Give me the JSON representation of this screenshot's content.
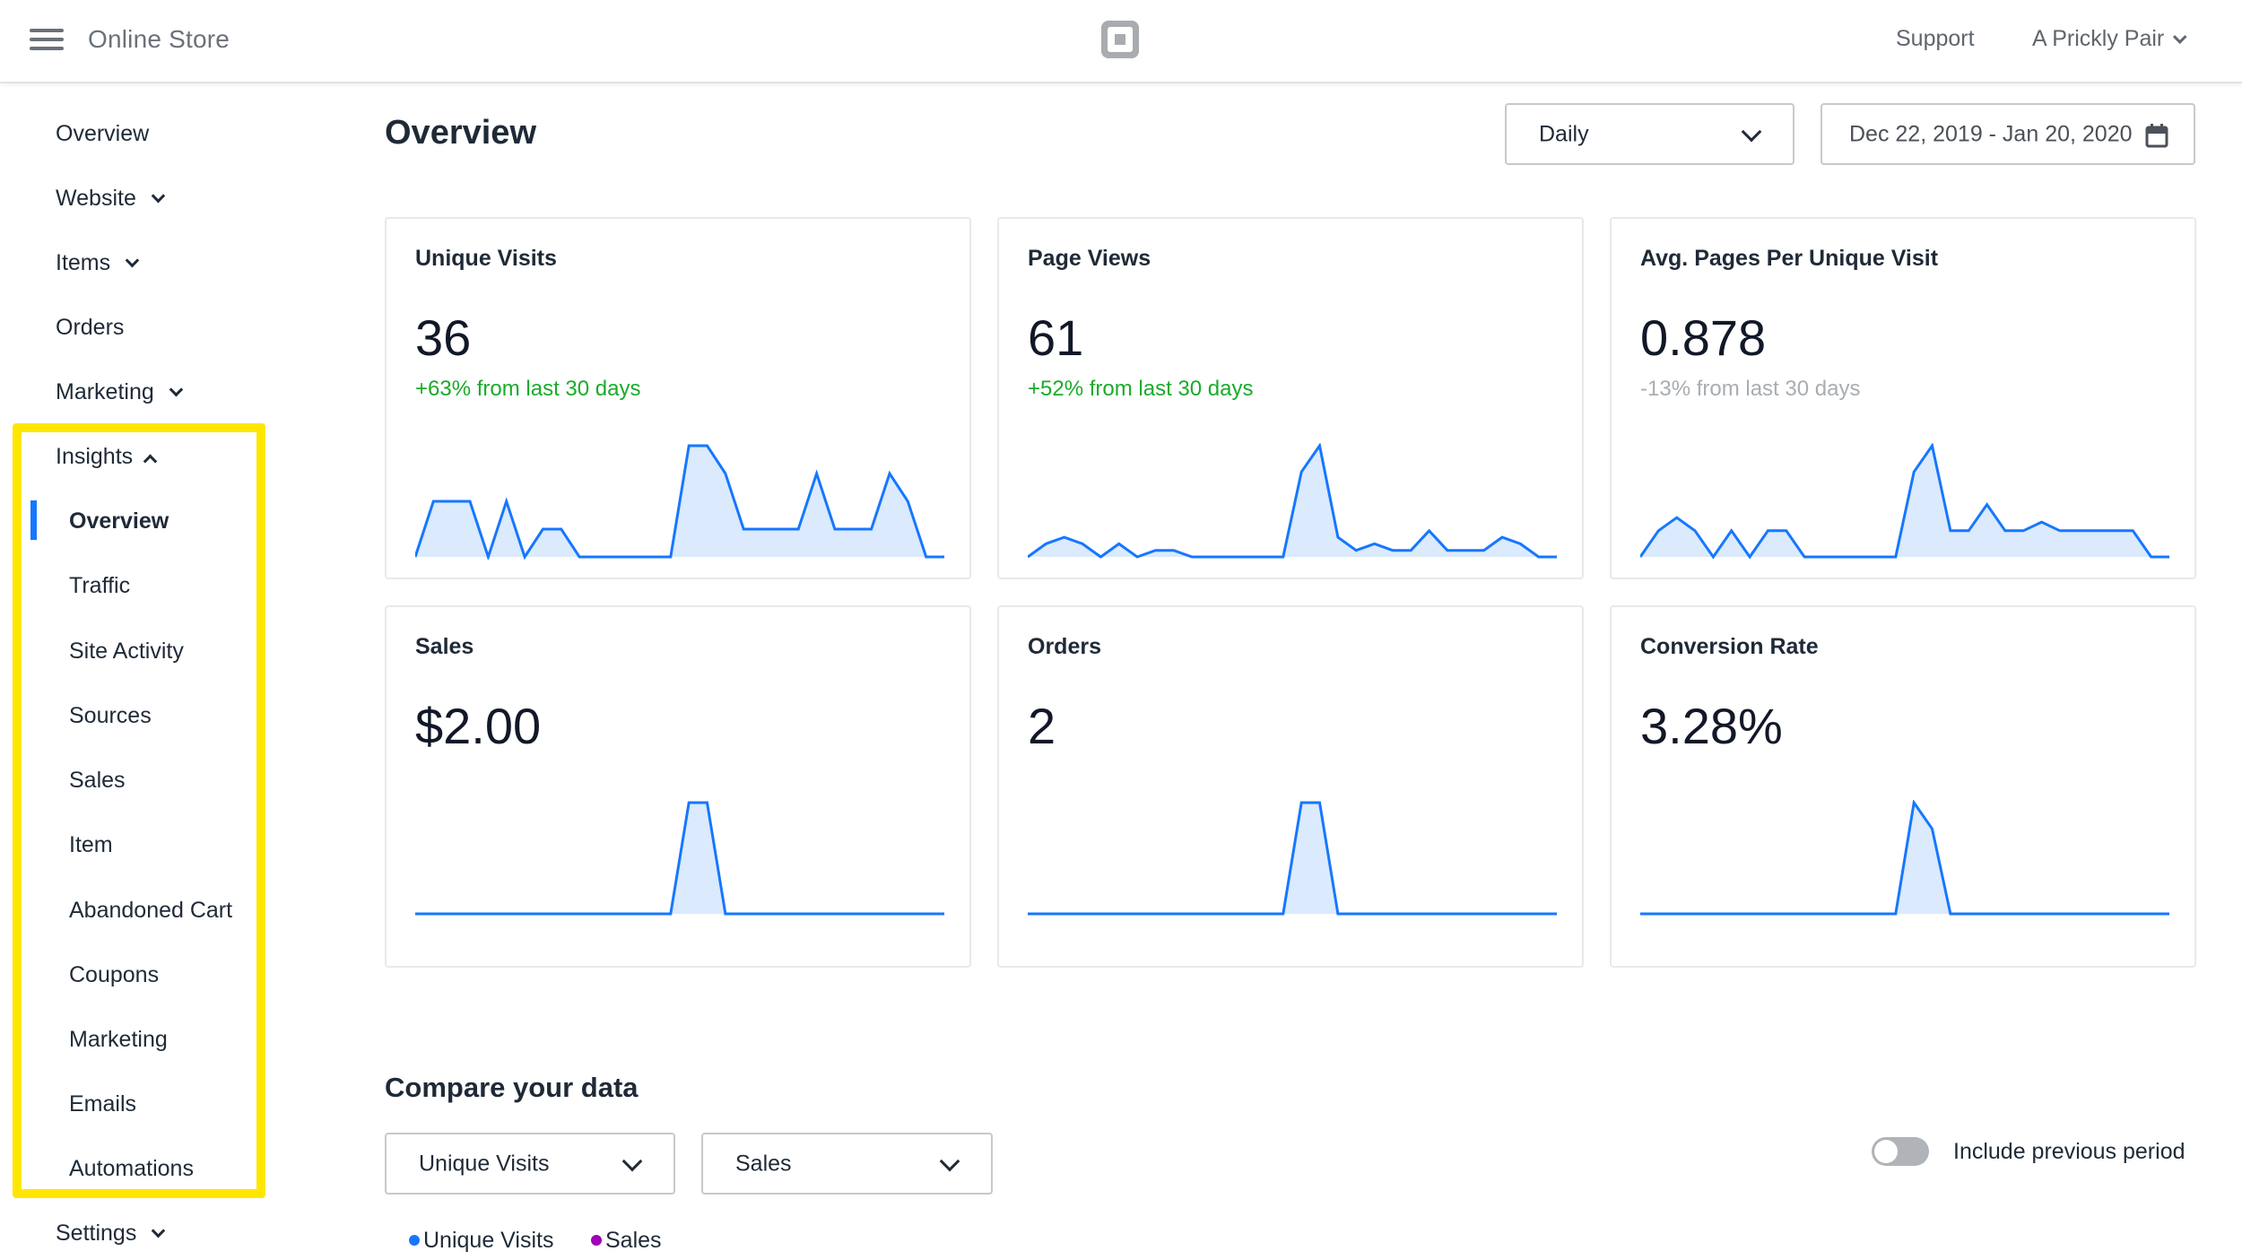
{
  "header": {
    "app_title": "Online Store",
    "menu_icon": "hamburger-icon",
    "logo_icon": "square-logo-icon",
    "support_label": "Support",
    "account_label": "A Prickly Pair"
  },
  "sidebar": {
    "items": [
      {
        "label": "Overview",
        "expandable": false
      },
      {
        "label": "Website",
        "expandable": true,
        "expanded": false
      },
      {
        "label": "Items",
        "expandable": true,
        "expanded": false
      },
      {
        "label": "Orders",
        "expandable": false
      },
      {
        "label": "Marketing",
        "expandable": true,
        "expanded": false
      },
      {
        "label": "Insights",
        "expandable": true,
        "expanded": true
      }
    ],
    "insights_subitems": [
      {
        "label": "Overview",
        "active": true
      },
      {
        "label": "Traffic"
      },
      {
        "label": "Site Activity"
      },
      {
        "label": "Sources"
      },
      {
        "label": "Sales"
      },
      {
        "label": "Item"
      },
      {
        "label": "Abandoned Cart"
      },
      {
        "label": "Coupons"
      },
      {
        "label": "Marketing"
      },
      {
        "label": "Emails"
      },
      {
        "label": "Automations"
      }
    ],
    "settings": {
      "label": "Settings",
      "expandable": true,
      "expanded": false
    },
    "highlight_color": "#ffe600"
  },
  "main": {
    "title": "Overview",
    "interval_select": {
      "value": "Daily"
    },
    "date_range": {
      "value": "Dec 22, 2019 - Jan 20, 2020",
      "icon": "calendar-icon"
    }
  },
  "cards": [
    {
      "title": "Unique Visits",
      "value": "36",
      "delta": "+63% from last 30 days",
      "trend": "up"
    },
    {
      "title": "Page Views",
      "value": "61",
      "delta": "+52% from last 30 days",
      "trend": "up"
    },
    {
      "title": "Avg. Pages Per Unique Visit",
      "value": "0.878",
      "delta": "-13% from last 30 days",
      "trend": "down"
    },
    {
      "title": "Sales",
      "value": "$2.00",
      "delta": "",
      "trend": "none"
    },
    {
      "title": "Orders",
      "value": "2",
      "delta": "",
      "trend": "none"
    },
    {
      "title": "Conversion Rate",
      "value": "3.28%",
      "delta": "",
      "trend": "none"
    }
  ],
  "compare": {
    "title": "Compare your data",
    "select_1": "Unique Visits",
    "select_2": "Sales",
    "legend": [
      {
        "label": "Unique Visits",
        "color": "#1677ff"
      },
      {
        "label": "Sales",
        "color": "#a000b8"
      }
    ],
    "toggle_label": "Include previous period",
    "toggle_on": false
  },
  "colors": {
    "accent": "#1677ff",
    "spark_fill": "#dbeafc",
    "positive": "#1aab2b",
    "muted": "#a9adb2"
  },
  "chart_data": [
    {
      "type": "area",
      "title": "Unique Visits",
      "x_range": [
        "Dec 22, 2019",
        "Jan 20, 2020"
      ],
      "values": [
        0,
        2,
        2,
        2,
        0,
        2,
        0,
        1,
        1,
        0,
        0,
        0,
        0,
        0,
        0,
        4,
        4,
        3,
        1,
        1,
        1,
        1,
        3,
        1,
        1,
        1,
        3,
        2,
        0,
        0
      ]
    },
    {
      "type": "area",
      "title": "Page Views",
      "x_range": [
        "Dec 22, 2019",
        "Jan 20, 2020"
      ],
      "values": [
        0,
        2,
        3,
        2,
        0,
        2,
        0,
        1,
        1,
        0,
        0,
        0,
        0,
        0,
        0,
        13,
        17,
        3,
        1,
        2,
        1,
        1,
        4,
        1,
        1,
        1,
        3,
        2,
        0,
        0
      ]
    },
    {
      "type": "area",
      "title": "Avg. Pages Per Unique Visit",
      "x_range": [
        "Dec 22, 2019",
        "Jan 20, 2020"
      ],
      "values": [
        0,
        1,
        1.5,
        1,
        0,
        1,
        0,
        1,
        1,
        0,
        0,
        0,
        0,
        0,
        0,
        3.25,
        4.25,
        1,
        1,
        2,
        1,
        1,
        1.33,
        1,
        1,
        1,
        1,
        1,
        0,
        0
      ]
    },
    {
      "type": "area",
      "title": "Sales",
      "x_range": [
        "Dec 22, 2019",
        "Jan 20, 2020"
      ],
      "values": [
        0,
        0,
        0,
        0,
        0,
        0,
        0,
        0,
        0,
        0,
        0,
        0,
        0,
        0,
        0,
        1,
        1,
        0,
        0,
        0,
        0,
        0,
        0,
        0,
        0,
        0,
        0,
        0,
        0,
        0
      ]
    },
    {
      "type": "area",
      "title": "Orders",
      "x_range": [
        "Dec 22, 2019",
        "Jan 20, 2020"
      ],
      "values": [
        0,
        0,
        0,
        0,
        0,
        0,
        0,
        0,
        0,
        0,
        0,
        0,
        0,
        0,
        0,
        1,
        1,
        0,
        0,
        0,
        0,
        0,
        0,
        0,
        0,
        0,
        0,
        0,
        0,
        0
      ]
    },
    {
      "type": "area",
      "title": "Conversion Rate",
      "x_range": [
        "Dec 22, 2019",
        "Jan 20, 2020"
      ],
      "values": [
        0,
        0,
        0,
        0,
        0,
        0,
        0,
        0,
        0,
        0,
        0,
        0,
        0,
        0,
        0,
        7.69,
        5.88,
        0,
        0,
        0,
        0,
        0,
        0,
        0,
        0,
        0,
        0,
        0,
        0,
        0
      ]
    }
  ]
}
